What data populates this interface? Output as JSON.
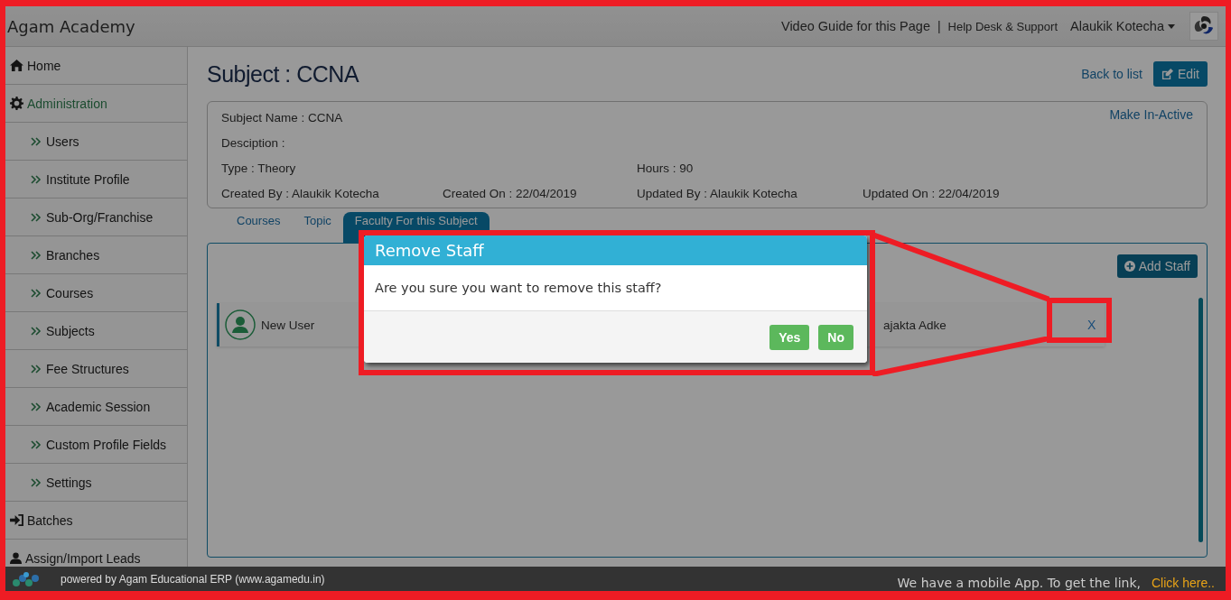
{
  "header": {
    "title": "Agam Academy",
    "links": [
      "Video Guide for this Page",
      "|",
      "Help Desk & Support"
    ],
    "user": "Alaukik Kotecha"
  },
  "sidebar": {
    "items": [
      {
        "label": "Home",
        "kind": "home",
        "selected": false
      },
      {
        "label": "Administration",
        "kind": "gear",
        "selected": true
      },
      {
        "label": "Users",
        "kind": "sub",
        "selected": false
      },
      {
        "label": "Institute Profile",
        "kind": "sub",
        "selected": false
      },
      {
        "label": "Sub-Org/Franchise",
        "kind": "sub",
        "selected": false
      },
      {
        "label": "Branches",
        "kind": "sub",
        "selected": false
      },
      {
        "label": "Courses",
        "kind": "sub",
        "selected": false
      },
      {
        "label": "Subjects",
        "kind": "sub",
        "selected": false
      },
      {
        "label": "Fee Structures",
        "kind": "sub",
        "selected": false
      },
      {
        "label": "Academic Session",
        "kind": "sub",
        "selected": false
      },
      {
        "label": "Custom Profile Fields",
        "kind": "sub",
        "selected": false
      },
      {
        "label": "Settings",
        "kind": "sub",
        "selected": false
      },
      {
        "label": "Batches",
        "kind": "enter",
        "selected": false
      },
      {
        "label": "Assign/Import Leads",
        "kind": "person",
        "selected": false
      }
    ]
  },
  "page": {
    "title": "Subject : CCNA",
    "back_link": "Back to list",
    "edit_button": "Edit"
  },
  "details": {
    "action": "Make In-Active",
    "rows": [
      [
        "Subject Name : CCNA"
      ],
      [
        "Desciption :"
      ],
      [
        "Type : Theory",
        "",
        "Hours : 90",
        ""
      ],
      [
        "Created By : Alaukik Kotecha",
        "Created On : 22/04/2019",
        "Updated By : Alaukik Kotecha",
        "Updated On : 22/04/2019"
      ]
    ]
  },
  "tabs": [
    {
      "label": "Courses",
      "selected": false
    },
    {
      "label": "Topic",
      "selected": false
    },
    {
      "label": "Faculty For this Subject",
      "selected": true
    }
  ],
  "staff_panel": {
    "add_button": "Add Staff",
    "rows": [
      {
        "name": "New User",
        "column_2": "ajakta Adke",
        "remove": "X"
      }
    ]
  },
  "modal": {
    "title": "Remove Staff",
    "message": "Are you sure you want to remove this staff?",
    "buttons": [
      "Yes",
      "No"
    ]
  },
  "footer": {
    "powered": "powered by Agam Educational ERP (www.agamedu.in)",
    "message": "We have a mobile App. To get the link,",
    "link": "Click here.."
  }
}
